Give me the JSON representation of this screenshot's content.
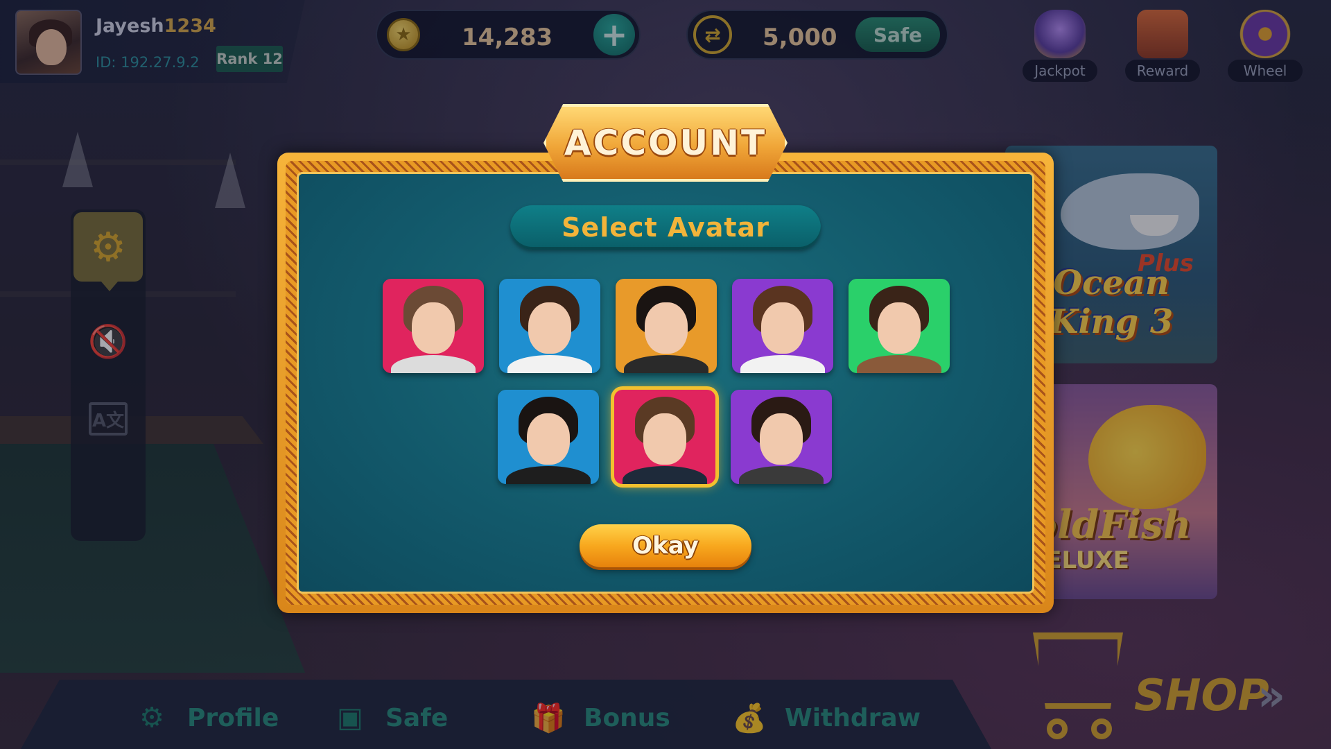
{
  "user": {
    "name_prefix": "Jayesh",
    "name_suffix": "1234",
    "id_text": "ID: 192.27.9.2",
    "rank_text": "Rank 12"
  },
  "balance": {
    "coins": "14,283",
    "coin_icon": "star-coin-icon",
    "safe_amount": "5,000",
    "safe_label": "Safe",
    "add_icon": "+",
    "exchange_icon": "⇄"
  },
  "top_actions": [
    {
      "label": "Jackpot",
      "icon": "jackpot-icon"
    },
    {
      "label": "Reward",
      "icon": "treasure-chest-icon"
    },
    {
      "label": "Wheel",
      "icon": "wheel-icon"
    }
  ],
  "side_panel": {
    "settings_icon": "⚙",
    "sound_icon": "🔇",
    "language_icon": "A文"
  },
  "games": [
    {
      "title_line1": "Ocean",
      "title_line2": "King",
      "number": "3",
      "badge": "Plus"
    },
    {
      "title": "oldFish",
      "subtitle": "DELUXE"
    }
  ],
  "bottom_nav": [
    {
      "label": "Profile",
      "icon": "profile-gear-icon"
    },
    {
      "label": "Safe",
      "icon": "safe-icon"
    },
    {
      "label": "Bonus",
      "icon": "gift-icon"
    },
    {
      "label": "Withdraw",
      "icon": "money-bag-icon"
    }
  ],
  "shop": {
    "label": "SHOP",
    "arrows": "»"
  },
  "modal": {
    "title": "ACCOUNT",
    "subtitle": "Select Avatar",
    "okay_label": "Okay",
    "selected_index": 6,
    "avatars": [
      {
        "bg": "#e0245e",
        "hair": "#6b4a35",
        "body": "#dcdcdc"
      },
      {
        "bg": "#1f8fd0",
        "hair": "#3a2418",
        "body": "#f2f2f2"
      },
      {
        "bg": "#e89a2a",
        "hair": "#1a1412",
        "body": "#2a2a2a"
      },
      {
        "bg": "#8a3ad0",
        "hair": "#5a3420",
        "body": "#f2f2f2"
      },
      {
        "bg": "#2ad06a",
        "hair": "#3a2418",
        "body": "#8a5a3a"
      },
      {
        "bg": "#1f8fd0",
        "hair": "#1a1412",
        "body": "#1e1e1e"
      },
      {
        "bg": "#e0245e",
        "hair": "#5a3a24",
        "body": "#1e2a3a"
      },
      {
        "bg": "#8a3ad0",
        "hair": "#2a1a14",
        "body": "#3a3a3a"
      }
    ]
  },
  "colors": {
    "accent_gold": "#f2b43a",
    "modal_teal": "#12586a",
    "nav_teal": "#2a8a7c"
  }
}
